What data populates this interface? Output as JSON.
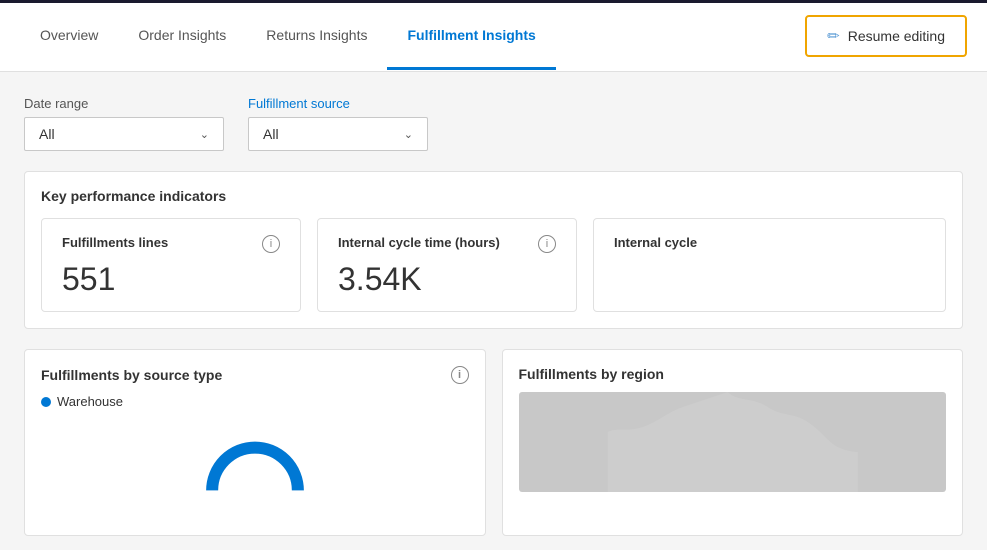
{
  "topBar": {
    "tabs": [
      {
        "id": "overview",
        "label": "Overview",
        "active": false
      },
      {
        "id": "order-insights",
        "label": "Order Insights",
        "active": false
      },
      {
        "id": "returns-insights",
        "label": "Returns Insights",
        "active": false
      },
      {
        "id": "fulfillment-insights",
        "label": "Fulfillment Insights",
        "active": true
      }
    ],
    "resumeEditing": {
      "label": "Resume editing",
      "icon": "pencil"
    }
  },
  "filters": {
    "dateRange": {
      "label": "Date range",
      "value": "All"
    },
    "fulfillmentSource": {
      "label": "Fulfillment source",
      "value": "All"
    }
  },
  "kpiSection": {
    "title": "Key performance indicators",
    "cards": [
      {
        "id": "fulfillment-lines",
        "label": "Fulfillments lines",
        "value": "551"
      },
      {
        "id": "internal-cycle-time",
        "label": "Internal cycle time (hours)",
        "value": "3.54K"
      },
      {
        "id": "internal-cycle-partial",
        "label": "Internal cycle",
        "value": ""
      }
    ]
  },
  "chartsRow": {
    "fulfillmentsBySourceType": {
      "title": "Fulfillments by source type",
      "legend": [
        {
          "label": "Warehouse",
          "color": "#0078d4"
        }
      ]
    },
    "fulfillmentsByRegion": {
      "title": "Fulfillments by region"
    }
  }
}
